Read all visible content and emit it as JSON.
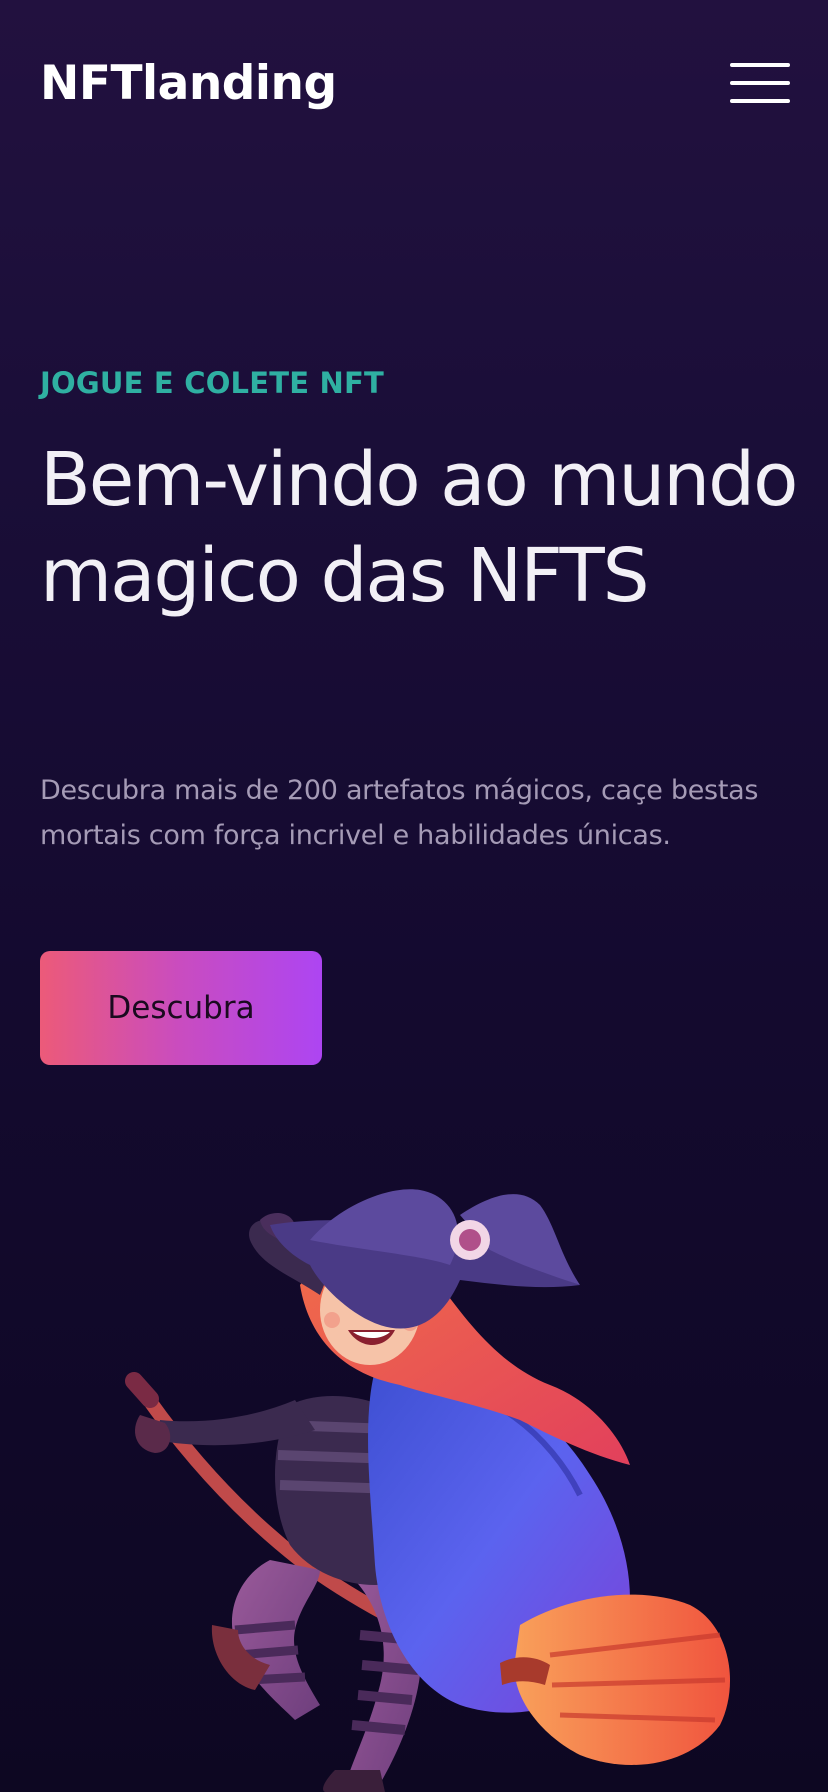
{
  "header": {
    "logo": "NFTlanding",
    "menu_icon": "hamburger-menu-icon"
  },
  "hero": {
    "eyebrow": "JOGUE E COLETE NFT",
    "headline": "Bem-vindo ao mundo magico das NFTS",
    "description": "Descubra mais de 200 artefatos mágicos, caçe bestas mortais com força incrivel e habilidades únicas.",
    "cta_label": "Descubra",
    "illustration": "witch-on-broom-illustration"
  },
  "colors": {
    "background_top": "#22113f",
    "background_bottom": "#0d0722",
    "eyebrow": "#2fb0a2",
    "headline": "#f2f0f6",
    "description": "#a59bb6",
    "cta_gradient_start": "#ec5a79",
    "cta_gradient_end": "#ad45f2"
  }
}
